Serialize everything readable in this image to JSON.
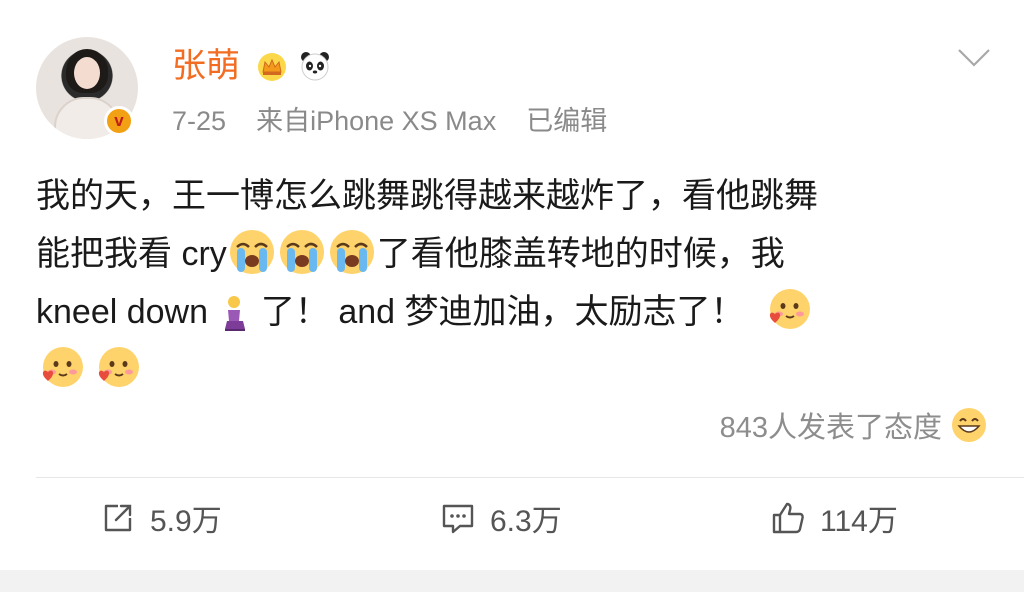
{
  "post": {
    "username": "张萌",
    "time": "7-25",
    "source": "来自iPhone XS Max",
    "edited": "已编辑",
    "content": {
      "line1": "我的天，王一博怎么跳舞跳得越来越炸了，看他跳舞",
      "line2a": "能把我看 cry",
      "line2b": "了看他膝盖转地的时候，我",
      "line3a": "kneel down ",
      "line3b": " 了！ and 梦迪加油，太励志了！"
    },
    "reactions_text": "843人发表了态度",
    "actions": {
      "repost": "5.9万",
      "comment": "6.3万",
      "like": "114万"
    }
  },
  "icons": {
    "verified": "v-badge-icon",
    "crown": "crown-icon",
    "panda": "panda-icon",
    "menu": "chevron-down-icon",
    "cry": "loudly-crying-emoji",
    "kneel": "kneeling-woman-emoji",
    "love": "blushing-heart-emoji",
    "reaction": "grinning-emoji",
    "repost": "share-icon",
    "comment": "comment-icon",
    "like": "thumbs-up-icon"
  },
  "colors": {
    "username": "#f26c21",
    "meta": "#8a8a8a",
    "text": "#1a1a1a",
    "badge": "#f2a114"
  }
}
